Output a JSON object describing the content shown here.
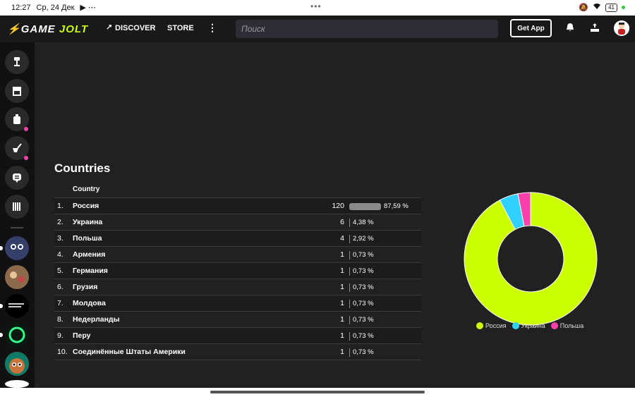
{
  "status_bar": {
    "time": "12:27",
    "date": "Ср, 24 Дек",
    "dots": "•••",
    "battery": "41"
  },
  "nav": {
    "logo_prefix": "GAME",
    "logo_suffix": "JOLT",
    "discover": "DISCOVER",
    "store": "STORE",
    "more": "⋮",
    "search_placeholder": "Поиск",
    "get_app": "Get App"
  },
  "section": {
    "title": "Countries",
    "column_header": "Country"
  },
  "rows": [
    {
      "idx": "1.",
      "name": "Россия",
      "count": "120",
      "pct": "87,59 %",
      "fraction": 0.8759
    },
    {
      "idx": "2.",
      "name": "Украина",
      "count": "6",
      "pct": "4,38 %",
      "fraction": 0.0438
    },
    {
      "idx": "3.",
      "name": "Польша",
      "count": "4",
      "pct": "2,92 %",
      "fraction": 0.0292
    },
    {
      "idx": "4.",
      "name": "Армения",
      "count": "1",
      "pct": "0,73 %",
      "fraction": 0.0073
    },
    {
      "idx": "5.",
      "name": "Германия",
      "count": "1",
      "pct": "0,73 %",
      "fraction": 0.0073
    },
    {
      "idx": "6.",
      "name": "Грузия",
      "count": "1",
      "pct": "0,73 %",
      "fraction": 0.0073
    },
    {
      "idx": "7.",
      "name": "Молдова",
      "count": "1",
      "pct": "0,73 %",
      "fraction": 0.0073
    },
    {
      "idx": "8.",
      "name": "Недерланды",
      "count": "1",
      "pct": "0,73 %",
      "fraction": 0.0073
    },
    {
      "idx": "9.",
      "name": "Перу",
      "count": "1",
      "pct": "0,73 %",
      "fraction": 0.0073
    },
    {
      "idx": "10.",
      "name": "Соединённые Штаты Америки",
      "count": "1",
      "pct": "0,73 %",
      "fraction": 0.0073
    }
  ],
  "chart_data": {
    "type": "pie",
    "donut": true,
    "categories": [
      "Россия",
      "Украина",
      "Польша"
    ],
    "values": [
      120,
      6,
      4
    ],
    "colors": [
      "#ccff00",
      "#2fd2ff",
      "#ff3fac"
    ],
    "legend_position": "bottom"
  },
  "colors": {
    "accent": "#ccff00",
    "notification": "#ff3fac",
    "background": "#212121"
  }
}
